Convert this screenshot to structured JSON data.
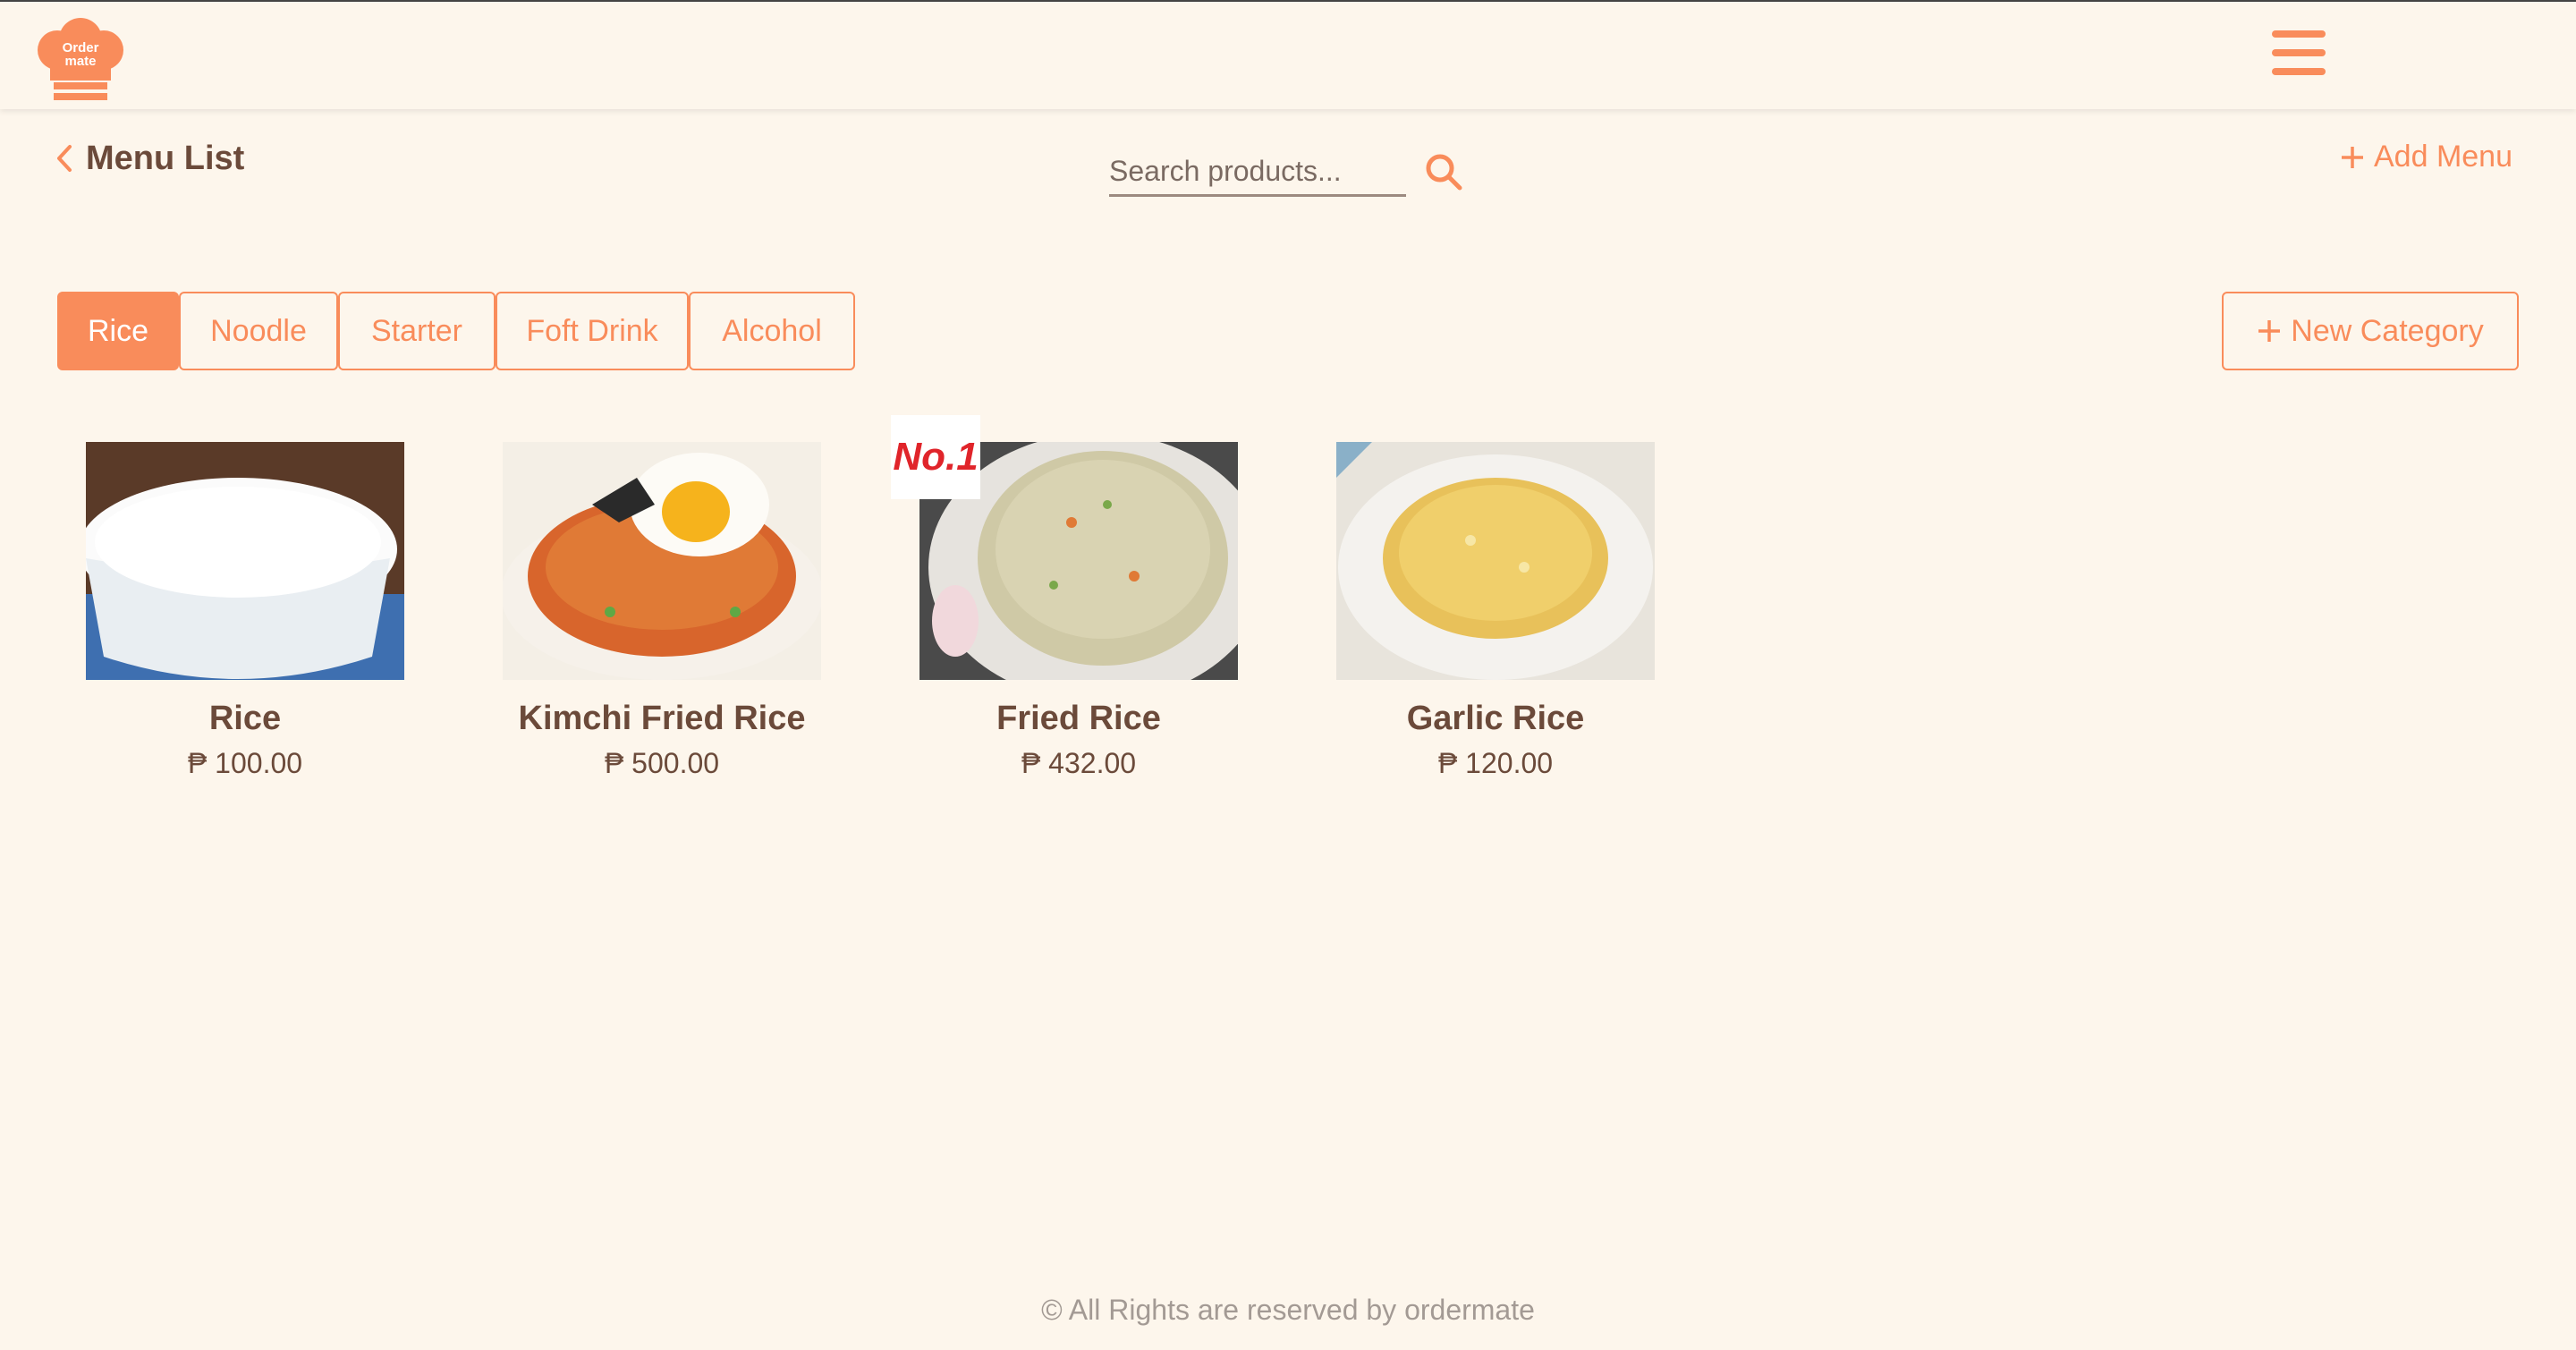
{
  "brand": {
    "logo_text_line1": "Order",
    "logo_text_line2": "mate",
    "accent": "#f98c5b"
  },
  "header": {
    "back_icon": "chevron-left-icon",
    "title": "Menu List",
    "search": {
      "placeholder": "Search products...",
      "value": ""
    },
    "add_menu_label": "Add Menu"
  },
  "categories": [
    {
      "label": "Rice",
      "active": true
    },
    {
      "label": "Noodle",
      "active": false
    },
    {
      "label": "Starter",
      "active": false
    },
    {
      "label": "Foft Drink",
      "active": false
    },
    {
      "label": "Alcohol",
      "active": false
    }
  ],
  "new_category_label": "New Category",
  "products": [
    {
      "name": "Rice",
      "price": "₱ 100.00"
    },
    {
      "name": "Kimchi Fried Rice",
      "price": "₱ 500.00"
    },
    {
      "name": "Fried Rice",
      "price": "₱ 432.00",
      "badge": "No.1"
    },
    {
      "name": "Garlic Rice",
      "price": "₱ 120.00"
    }
  ],
  "footer": "© All Rights are reserved by ordermate"
}
